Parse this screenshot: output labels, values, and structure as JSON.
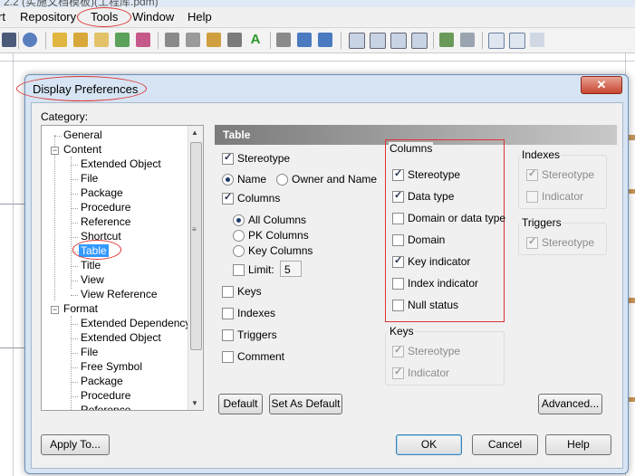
{
  "app": {
    "title_fragment": "2.2 (实施文档模板)(工程库.pdm)",
    "menus": [
      "rt",
      "Repository",
      "Tools",
      "Window",
      "Help"
    ]
  },
  "dialog": {
    "title": "Display Preferences",
    "close_symbol": "✕",
    "category_label": "Category:",
    "tree": {
      "general": "General",
      "content": "Content",
      "content_children": [
        "Extended Object",
        "File",
        "Package",
        "Procedure",
        "Reference",
        "Shortcut",
        "Table",
        "Title",
        "View",
        "View Reference"
      ],
      "format": "Format",
      "format_children": [
        "Extended Dependency",
        "Extended Object",
        "File",
        "Free Symbol",
        "Package",
        "Procedure",
        "Reference"
      ]
    },
    "panel": {
      "header": "Table",
      "stereotype": "Stereotype",
      "name": "Name",
      "owner_and_name": "Owner and Name",
      "columns": "Columns",
      "all_columns": "All Columns",
      "pk_columns": "PK Columns",
      "key_columns": "Key Columns",
      "limit": "Limit:",
      "limit_value": "5",
      "keys": "Keys",
      "indexes": "Indexes",
      "triggers": "Triggers",
      "comment": "Comment"
    },
    "columns_group": {
      "title": "Columns",
      "items": [
        "Stereotype",
        "Data type",
        "Domain or data type",
        "Domain",
        "Key indicator",
        "Index indicator",
        "Null status"
      ]
    },
    "keys_group": {
      "title": "Keys",
      "items": [
        "Stereotype",
        "Indicator"
      ]
    },
    "indexes_group": {
      "title": "Indexes",
      "items": [
        "Stereotype",
        "Indicator"
      ]
    },
    "triggers_group": {
      "title": "Triggers",
      "items": [
        "Stereotype"
      ]
    },
    "buttons": {
      "default": "Default",
      "set_as_default": "Set As Default",
      "advanced": "Advanced...",
      "apply_to": "Apply To...",
      "ok": "OK",
      "cancel": "Cancel",
      "help": "Help"
    }
  }
}
